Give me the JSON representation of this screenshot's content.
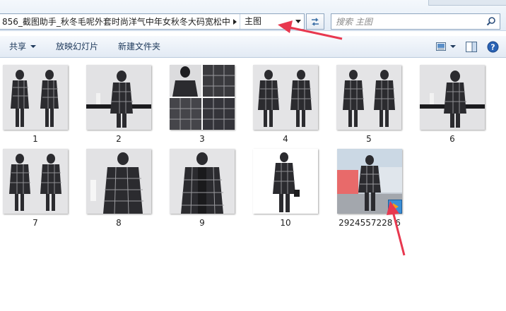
{
  "address_bar": {
    "path_text": "856_截图助手_秋冬毛呢外套时尚洋气中年女秋冬大码宽松中...",
    "current_folder": "主图"
  },
  "search": {
    "placeholder": "搜索 主图",
    "icon": "magnifier-icon"
  },
  "toolbar": {
    "share_label": "共享",
    "slideshow_label": "放映幻灯片",
    "new_folder_label": "新建文件夹",
    "view_icon": "view-options-icon",
    "pane_icon": "preview-pane-icon",
    "help_icon": "help-icon"
  },
  "files": [
    {
      "name": "1",
      "kind": "jpg"
    },
    {
      "name": "2",
      "kind": "jpg"
    },
    {
      "name": "3",
      "kind": "jpg"
    },
    {
      "name": "4",
      "kind": "jpg"
    },
    {
      "name": "5",
      "kind": "jpg"
    },
    {
      "name": "6",
      "kind": "jpg"
    },
    {
      "name": "7",
      "kind": "jpg"
    },
    {
      "name": "8",
      "kind": "jpg"
    },
    {
      "name": "9",
      "kind": "jpg"
    },
    {
      "name": "10",
      "kind": "jpg"
    },
    {
      "name": "2924557228 6",
      "kind": "video",
      "badge_icon": "media-player-icon"
    }
  ],
  "annotations": {
    "arrow_color": "#e8384f"
  }
}
